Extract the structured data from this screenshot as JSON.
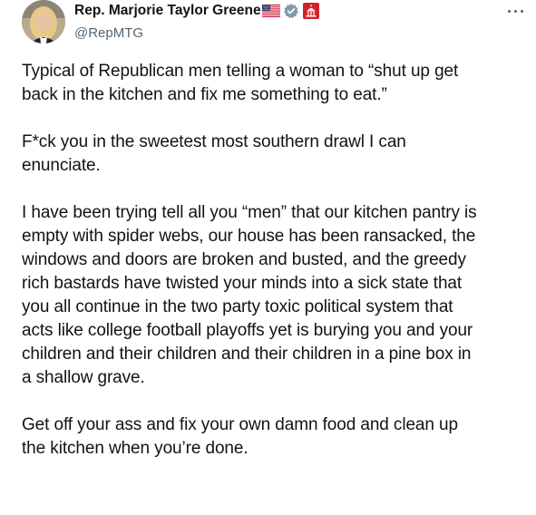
{
  "author": {
    "display_name": "Rep. Marjorie Taylor Greene",
    "handle": "@RepMTG",
    "flag_icon": "us-flag-icon",
    "verified_icon": "verified-badge-icon",
    "verified_color": "#829aab",
    "affiliation_icon": "capitol-icon",
    "affiliation_color": "#d1232a"
  },
  "menu": {
    "icon": "more-options-icon"
  },
  "tweet": {
    "paragraphs": [
      "Typical of Republican men telling a woman to “shut up get\nback in the kitchen and fix me something to eat.”",
      "F*ck you in the sweetest most southern drawl I can\nenunciate.",
      "I have been trying tell all you “men” that our kitchen pantry is\nempty with spider webs, our house has been ransacked, the\nwindows and doors are broken and busted, and the greedy\nrich bastards have twisted your minds into a sick state that\nyou all continue in the two party toxic political system that\nacts like college football playoffs yet is burying you and your\nchildren and their children and their children in a pine box in\na shallow grave.",
      "Get off your ass and fix your own damn food and clean up\nthe kitchen when you’re done."
    ]
  }
}
